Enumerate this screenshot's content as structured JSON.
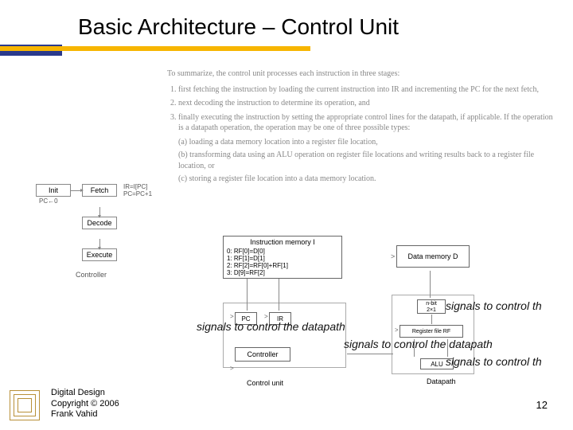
{
  "slide": {
    "title": "Basic Architecture – Control Unit",
    "page_number": "12"
  },
  "summary": {
    "intro": "To summarize, the control unit processes each instruction in three stages:",
    "steps": [
      "first fetching the instruction by loading the current instruction into IR and incrementing the PC for the next fetch,",
      "next decoding the instruction to determine its operation, and",
      "finally executing the instruction by setting the appropriate control lines for the datapath, if applicable. If the operation is a datapath operation, the operation may be one of three possible types:"
    ],
    "subs": [
      "(a) loading a data memory location into a register file location,",
      "(b) transforming data using an ALU operation on register file locations and writing results back to a register file location, or",
      "(c) storing a register file location into a data memory location."
    ]
  },
  "fsm": {
    "init": "Init",
    "fetch": "Fetch",
    "side1": "IR=I[PC]",
    "side2": "PC=PC+1",
    "decode": "Decode",
    "execute": "Execute",
    "ctrl": "Controller",
    "pc_label": "PC←0"
  },
  "diagram": {
    "imem_title": "Instruction memory  I",
    "imem_lines": [
      "0: RF[0]=D[0]",
      "1: RF[1]=D[1]",
      "2: RF[2]=RF[0]+RF[1]",
      "3: D[9]=RF[2]"
    ],
    "dmem": "Data memory D",
    "pc": "PC",
    "ir": "IR",
    "controller": "Controller",
    "control_unit": "Control unit",
    "mux1": "n-bit",
    "mux2": "2×1",
    "rf": "Register file RF",
    "alu": "ALU",
    "datapath": "Datapath"
  },
  "signals": {
    "s1": "signals to control th",
    "s2": "signals to control the datapath",
    "s3": "signals to control the datapath",
    "s4": "signals to control th"
  },
  "footer": {
    "line1": "Digital Design",
    "line2": "Copyright © 2006",
    "line3": "Frank Vahid"
  }
}
